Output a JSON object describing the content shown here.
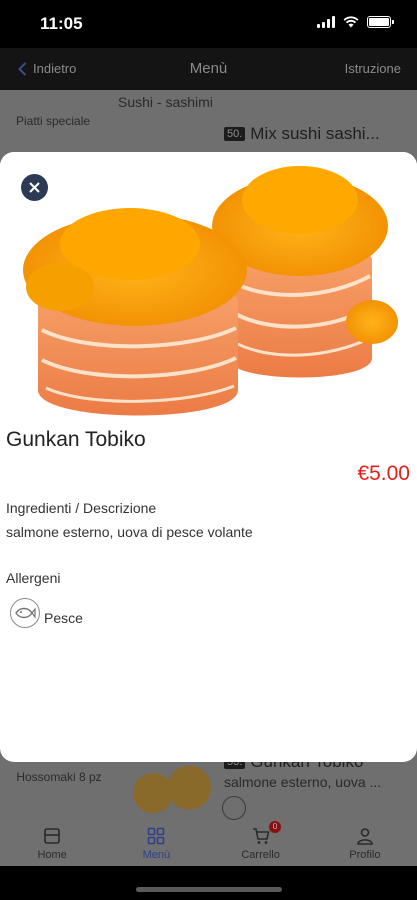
{
  "status_bar": {
    "time": "11:05"
  },
  "nav": {
    "back_label": "Indietro",
    "title": "Menù",
    "right_label": "Istruzione"
  },
  "background": {
    "category_title": "Sushi - sashimi",
    "side_label_top": "Piatti speciale",
    "item_top": {
      "number": "50.",
      "name": "Mix sushi sashi..."
    },
    "side_label_bottom": "Hossomaki 8 pz",
    "item_bottom": {
      "number": "53.",
      "name": "Gunkan Tobiko",
      "desc": "salmone esterno, uova ..."
    }
  },
  "modal": {
    "close_icon": "close-icon",
    "item_name": "Gunkan Tobiko",
    "price": "€5.00",
    "description_label": "Ingredienti / Descrizione",
    "description": "salmone esterno, uova di pesce volante",
    "allergens_label": "Allergeni",
    "allergens": [
      {
        "name": "Pesce",
        "icon": "fish-icon"
      }
    ]
  },
  "tabs": [
    {
      "label": "Home",
      "icon": "home-icon",
      "active": false
    },
    {
      "label": "Menù",
      "icon": "menu-grid-icon",
      "active": true
    },
    {
      "label": "Carrello",
      "icon": "cart-icon",
      "active": false,
      "badge": "0"
    },
    {
      "label": "Profilo",
      "icon": "profile-icon",
      "active": false
    }
  ],
  "colors": {
    "price": "#e3201c",
    "close_button": "#2b3a55",
    "active_tab": "#2f3f8a"
  }
}
